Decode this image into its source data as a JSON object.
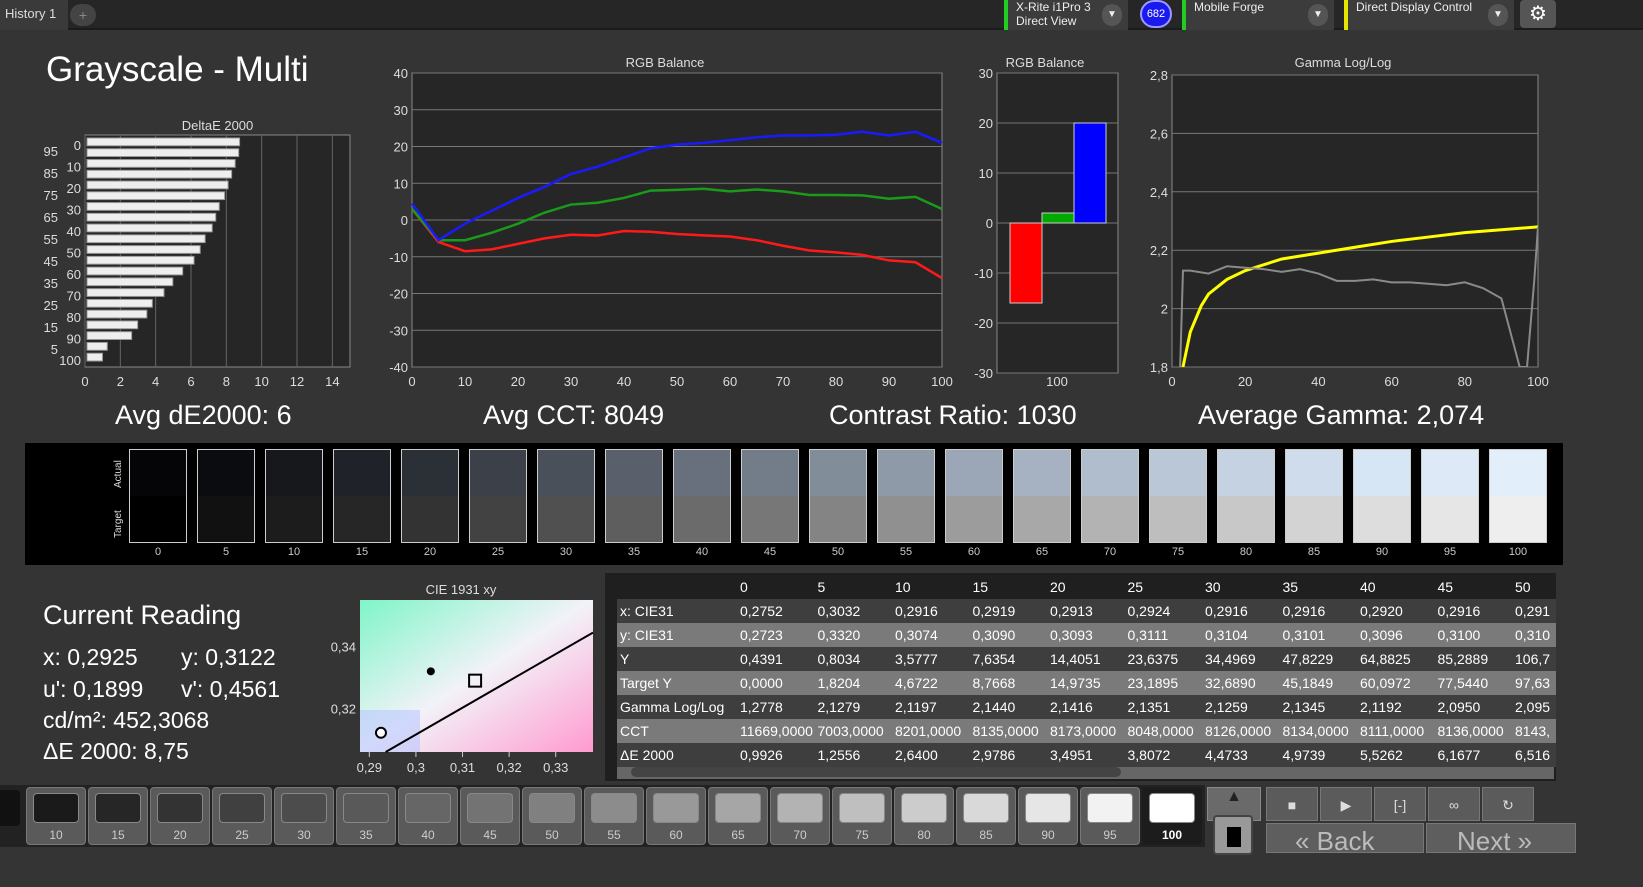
{
  "topbar": {
    "tab": "History 1",
    "add": "+",
    "meter": {
      "line1": "X-Rite i1Pro 3",
      "line2": "Direct View",
      "color": "#22cc22"
    },
    "badge": "682",
    "display": {
      "label": "Mobile Forge",
      "color": "#22cc22"
    },
    "control": {
      "label": "Direct Display Control",
      "color": "#e5e500"
    }
  },
  "title": "Grayscale - Multi",
  "summary": {
    "avg_de": "Avg dE2000: 6",
    "avg_cct": "Avg CCT: 8049",
    "contrast": "Contrast Ratio: 1030",
    "gamma": "Average Gamma: 2,074"
  },
  "chart_data": [
    {
      "type": "bar",
      "orientation": "horizontal",
      "title": "DeltaE 2000",
      "categories": [
        "0",
        "5",
        "10",
        "15",
        "20",
        "25",
        "30",
        "35",
        "40",
        "45",
        "50",
        "55",
        "60",
        "65",
        "70",
        "75",
        "80",
        "85",
        "90",
        "95",
        "100"
      ],
      "values": [
        0.99,
        1.26,
        2.64,
        2.98,
        3.5,
        3.81,
        4.47,
        4.97,
        5.53,
        6.17,
        6.52,
        6.8,
        7.2,
        7.4,
        7.6,
        7.9,
        8.1,
        8.3,
        8.5,
        8.7,
        8.75
      ],
      "xlim": [
        0,
        15
      ],
      "xticks": [
        "0",
        "2",
        "4",
        "6",
        "8",
        "10",
        "12",
        "14"
      ],
      "yticks_left": [
        "95",
        "85",
        "75",
        "65",
        "55",
        "45",
        "35",
        "25",
        "15",
        "5"
      ],
      "yticks_right": [
        "100",
        "90",
        "80",
        "70",
        "60",
        "50",
        "40",
        "30",
        "20",
        "10",
        "0"
      ]
    },
    {
      "type": "line",
      "title": "RGB Balance",
      "x": [
        0,
        5,
        10,
        15,
        20,
        25,
        30,
        35,
        40,
        45,
        50,
        55,
        60,
        65,
        70,
        75,
        80,
        85,
        90,
        95,
        100
      ],
      "ylim": [
        -40,
        40
      ],
      "xlim": [
        0,
        100
      ],
      "yticks": [
        "40",
        "30",
        "20",
        "10",
        "0",
        "-10",
        "-20",
        "-30",
        "-40"
      ],
      "xticks": [
        "0",
        "10",
        "20",
        "30",
        "40",
        "50",
        "60",
        "70",
        "80",
        "90",
        "100"
      ],
      "series": [
        {
          "color": "#ff1a1a",
          "values": [
            3,
            -6,
            -8.5,
            -8,
            -6.5,
            -5,
            -4,
            -4.2,
            -3,
            -3.2,
            -3.8,
            -4.2,
            -4.5,
            -5.5,
            -7,
            -8.3,
            -8.8,
            -9.5,
            -11,
            -11.5,
            -15.8
          ]
        },
        {
          "color": "#1a9a1a",
          "values": [
            3,
            -5.5,
            -5.5,
            -3.5,
            -1,
            2,
            4.2,
            4.7,
            6,
            8,
            8.2,
            8.5,
            7.8,
            8.3,
            7.8,
            6.8,
            6.8,
            6.7,
            5.8,
            6.3,
            3
          ]
        },
        {
          "color": "#1a1aff",
          "values": [
            4.5,
            -5.5,
            -1,
            2.5,
            6,
            9,
            12.5,
            14.5,
            17,
            19.5,
            20.5,
            21,
            21.7,
            22.5,
            23,
            23,
            23.2,
            24,
            23,
            24,
            21
          ]
        }
      ]
    },
    {
      "type": "bar",
      "title": "RGB Balance",
      "categories": [
        "100"
      ],
      "ylim": [
        -30,
        30
      ],
      "yticks": [
        "30",
        "20",
        "10",
        "0",
        "-10",
        "-20",
        "-30"
      ],
      "series": [
        {
          "color": "#ff0000",
          "values": [
            -16
          ]
        },
        {
          "color": "#00aa00",
          "values": [
            2
          ]
        },
        {
          "color": "#0000ff",
          "values": [
            20
          ]
        }
      ]
    },
    {
      "type": "line",
      "title": "Gamma Log/Log",
      "ylim": [
        1.8,
        2.8
      ],
      "xlim": [
        0,
        100
      ],
      "yticks": [
        "2,8",
        "2,6",
        "2,4",
        "2,2",
        "2",
        "1,8"
      ],
      "xticks": [
        "0",
        "20",
        "40",
        "60",
        "80",
        "100"
      ],
      "series": [
        {
          "color": "#ffff00",
          "x": [
            3,
            5,
            8,
            10,
            15,
            20,
            30,
            40,
            50,
            60,
            70,
            80,
            90,
            100
          ],
          "values": [
            1.8,
            1.92,
            2.01,
            2.05,
            2.1,
            2.13,
            2.17,
            2.19,
            2.21,
            2.23,
            2.245,
            2.26,
            2.27,
            2.28
          ]
        },
        {
          "color": "#8a8a8a",
          "x": [
            1,
            3,
            5,
            10,
            15,
            20,
            25,
            30,
            35,
            40,
            45,
            50,
            55,
            60,
            65,
            70,
            75,
            80,
            85,
            90,
            95,
            97,
            99,
            100
          ],
          "values": [
            1.28,
            2.13,
            2.13,
            2.12,
            2.145,
            2.14,
            2.135,
            2.126,
            2.135,
            2.12,
            2.095,
            2.095,
            2.1,
            2.09,
            2.09,
            2.085,
            2.08,
            2.09,
            2.07,
            2.035,
            1.8,
            1.8,
            2.1,
            2.28
          ]
        }
      ]
    },
    {
      "type": "scatter",
      "title": "CIE 1931 xy",
      "xticks": [
        "0,29",
        "0,3",
        "0,31",
        "0,32",
        "0,33"
      ],
      "yticks": [
        "0,34",
        "0,32"
      ],
      "xlim": [
        0.288,
        0.338
      ],
      "ylim": [
        0.306,
        0.355
      ],
      "points": [
        {
          "x": 0.3032,
          "y": 0.332,
          "marker": "dot"
        },
        {
          "x": 0.3127,
          "y": 0.329,
          "marker": "square-target"
        },
        {
          "x": 0.2925,
          "y": 0.3122,
          "marker": "circle"
        }
      ]
    }
  ],
  "swatches": {
    "actual_label": "Actual",
    "target_label": "Target",
    "items": [
      {
        "l": "0",
        "a": "#050508",
        "t": "#000000"
      },
      {
        "l": "5",
        "a": "#0b0c0f",
        "t": "#111111"
      },
      {
        "l": "10",
        "a": "#16181c",
        "t": "#1c1c1c"
      },
      {
        "l": "15",
        "a": "#1f2228",
        "t": "#262626"
      },
      {
        "l": "20",
        "a": "#2b2f36",
        "t": "#333333"
      },
      {
        "l": "25",
        "a": "#3b4049",
        "t": "#424242"
      },
      {
        "l": "30",
        "a": "#4a505a",
        "t": "#505050"
      },
      {
        "l": "35",
        "a": "#59606b",
        "t": "#5e5e5e"
      },
      {
        "l": "40",
        "a": "#67707c",
        "t": "#6b6b6b"
      },
      {
        "l": "45",
        "a": "#737d8a",
        "t": "#777777"
      },
      {
        "l": "50",
        "a": "#828d9a",
        "t": "#848484"
      },
      {
        "l": "55",
        "a": "#8f9aa8",
        "t": "#909090"
      },
      {
        "l": "60",
        "a": "#9ba7b6",
        "t": "#9c9c9c"
      },
      {
        "l": "65",
        "a": "#a6b2c1",
        "t": "#a8a8a8"
      },
      {
        "l": "70",
        "a": "#b0bdcc",
        "t": "#b3b3b3"
      },
      {
        "l": "75",
        "a": "#bac7d7",
        "t": "#bebebe"
      },
      {
        "l": "80",
        "a": "#c4d2e2",
        "t": "#c8c8c8"
      },
      {
        "l": "85",
        "a": "#cedcec",
        "t": "#d3d3d3"
      },
      {
        "l": "90",
        "a": "#d7e6f5",
        "t": "#dddddd"
      },
      {
        "l": "95",
        "a": "#dde9f7",
        "t": "#e6e6e6"
      },
      {
        "l": "100",
        "a": "#e2eefa",
        "t": "#eeeeee"
      }
    ]
  },
  "reading": {
    "title": "Current Reading",
    "x": "x: 0,2925",
    "y": "y: 0,3122",
    "u": "u': 0,1899",
    "v": "v': 0,4561",
    "cd": "cd/m²: 452,3068",
    "de": "ΔE 2000: 8,75"
  },
  "table": {
    "headers": [
      "0",
      "5",
      "10",
      "15",
      "20",
      "25",
      "30",
      "35",
      "40",
      "45",
      "50"
    ],
    "rows": [
      {
        "label": "x: CIE31",
        "cells": [
          "0,2752",
          "0,3032",
          "0,2916",
          "0,2919",
          "0,2913",
          "0,2924",
          "0,2916",
          "0,2916",
          "0,2920",
          "0,2916",
          "0,291"
        ]
      },
      {
        "label": "y: CIE31",
        "cells": [
          "0,2723",
          "0,3320",
          "0,3074",
          "0,3090",
          "0,3093",
          "0,3111",
          "0,3104",
          "0,3101",
          "0,3096",
          "0,3100",
          "0,310"
        ]
      },
      {
        "label": "Y",
        "cells": [
          "0,4391",
          "0,8034",
          "3,5777",
          "7,6354",
          "14,4051",
          "23,6375",
          "34,4969",
          "47,8229",
          "64,8825",
          "85,2889",
          "106,7"
        ]
      },
      {
        "label": "Target Y",
        "cells": [
          "0,0000",
          "1,8204",
          "4,6722",
          "8,7668",
          "14,9735",
          "23,1895",
          "32,6890",
          "45,1849",
          "60,0972",
          "77,5440",
          "97,63"
        ]
      },
      {
        "label": "Gamma Log/Log",
        "cells": [
          "1,2778",
          "2,1279",
          "2,1197",
          "2,1440",
          "2,1416",
          "2,1351",
          "2,1259",
          "2,1345",
          "2,1192",
          "2,0950",
          "2,095"
        ]
      },
      {
        "label": "CCT",
        "cells": [
          "11669,0000",
          "7003,0000",
          "8201,0000",
          "8135,0000",
          "8173,0000",
          "8048,0000",
          "8126,0000",
          "8134,0000",
          "8111,0000",
          "8136,0000",
          "8143,"
        ]
      },
      {
        "label": "ΔE 2000",
        "cells": [
          "0,9926",
          "1,2556",
          "2,6400",
          "2,9786",
          "3,4951",
          "3,8072",
          "4,4733",
          "4,9739",
          "5,5262",
          "6,1677",
          "6,516"
        ]
      }
    ]
  },
  "patches": [
    {
      "l": "10",
      "c": "#1a1a1a"
    },
    {
      "l": "15",
      "c": "#262626"
    },
    {
      "l": "20",
      "c": "#333333"
    },
    {
      "l": "25",
      "c": "#404040"
    },
    {
      "l": "30",
      "c": "#4c4c4c"
    },
    {
      "l": "35",
      "c": "#595959"
    },
    {
      "l": "40",
      "c": "#666666"
    },
    {
      "l": "45",
      "c": "#737373"
    },
    {
      "l": "50",
      "c": "#808080"
    },
    {
      "l": "55",
      "c": "#8c8c8c"
    },
    {
      "l": "60",
      "c": "#999999"
    },
    {
      "l": "65",
      "c": "#a6a6a6"
    },
    {
      "l": "70",
      "c": "#b3b3b3"
    },
    {
      "l": "75",
      "c": "#bfbfbf"
    },
    {
      "l": "80",
      "c": "#cccccc"
    },
    {
      "l": "85",
      "c": "#d9d9d9"
    },
    {
      "l": "90",
      "c": "#e6e6e6"
    },
    {
      "l": "95",
      "c": "#f2f2f2"
    },
    {
      "l": "100",
      "c": "#ffffff",
      "selected": true
    }
  ],
  "controls": {
    "stop": "■",
    "play": "▶",
    "measure": "[-]",
    "loop": "∞",
    "refresh": "↻",
    "back": "« Back",
    "next": "Next »"
  }
}
